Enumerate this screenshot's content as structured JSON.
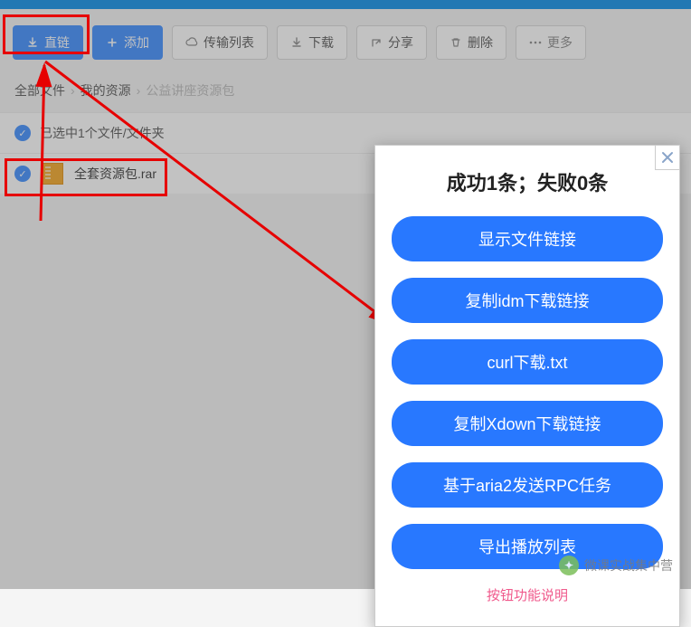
{
  "toolbar": {
    "direct_link": "直链",
    "add": "添加",
    "transfer_list": "传输列表",
    "download": "下载",
    "share": "分享",
    "delete": "删除",
    "more": "更多"
  },
  "breadcrumb": {
    "root": "全部文件",
    "level1": "我的资源",
    "current": "公益讲座资源包"
  },
  "selection_bar": "已选中1个文件/文件夹",
  "files": [
    {
      "name": "全套资源包.rar"
    }
  ],
  "dialog": {
    "title": "成功1条；失败0条",
    "actions": [
      "显示文件链接",
      "复制idm下载链接",
      "curl下载.txt",
      "复制Xdown下载链接",
      "基于aria2发送RPC任务",
      "导出播放列表"
    ],
    "footer": "按钮功能说明"
  },
  "watermark": "微课实战集中营"
}
